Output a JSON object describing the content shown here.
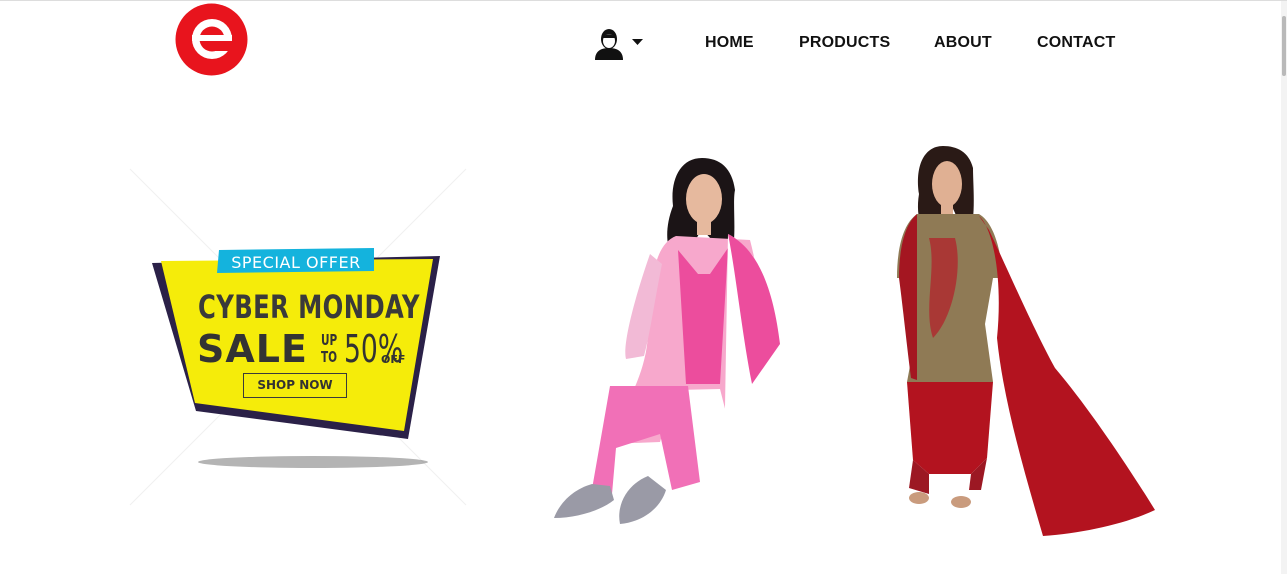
{
  "brand": {
    "logo_icon": "e-logo-icon",
    "color": "#e8141d"
  },
  "header": {
    "user_menu": {
      "icon": "user-icon",
      "caret": "caret-down-icon"
    },
    "nav": [
      {
        "label": "HOME"
      },
      {
        "label": "PRODUCTS"
      },
      {
        "label": "ABOUT"
      },
      {
        "label": "CONTACT"
      }
    ]
  },
  "hero": {
    "banner": {
      "tag": "SPECIAL OFFER",
      "headline": "CYBER MONDAY",
      "sale": "SALE",
      "up": "UP",
      "to": "TO",
      "discount": "50%",
      "off": "OFF",
      "cta": "SHOP NOW",
      "colors": {
        "tag": "#14b3dd",
        "panel": "#f5ec0a",
        "dark": "#2b2148"
      }
    },
    "products": [
      {
        "name": "model-pink-salwar-suit",
        "colors": [
          "#f06fb4",
          "#ffffff"
        ]
      },
      {
        "name": "model-red-patiala-suit",
        "colors": [
          "#b3131f",
          "#8f7a55"
        ]
      }
    ]
  }
}
